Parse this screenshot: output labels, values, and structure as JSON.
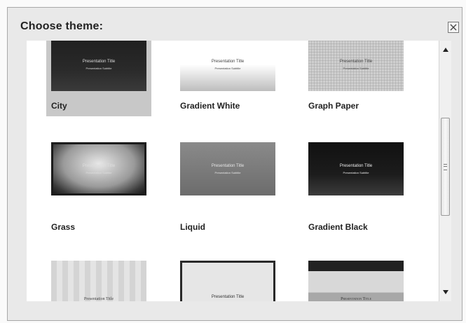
{
  "dialog": {
    "title": "Choose theme:"
  },
  "themes": [
    {
      "label": "City",
      "thumb_title": "Presentation Title",
      "thumb_subtitle": "Presentation Subtitle",
      "selected": true
    },
    {
      "label": "Gradient White",
      "thumb_title": "Presentation Title",
      "thumb_subtitle": "Presentation Subtitle",
      "selected": false
    },
    {
      "label": "Graph Paper",
      "thumb_title": "Presentation Title",
      "thumb_subtitle": "Presentation Subtitle",
      "selected": false
    },
    {
      "label": "Grass",
      "thumb_title": "Presentation Title",
      "thumb_subtitle": "Presentation Subtitle",
      "selected": false
    },
    {
      "label": "Liquid",
      "thumb_title": "Presentation Title",
      "thumb_subtitle": "Presentation Subtitle",
      "selected": false
    },
    {
      "label": "Gradient Black",
      "thumb_title": "Presentation Title",
      "thumb_subtitle": "Presentation Subtitle",
      "selected": false
    },
    {
      "label": "",
      "thumb_title": "Presentation Title",
      "thumb_subtitle": "",
      "selected": false
    },
    {
      "label": "",
      "thumb_title": "Presentation Title",
      "thumb_subtitle": "",
      "selected": false
    },
    {
      "label": "",
      "thumb_title": "Presentation Title",
      "thumb_subtitle": "",
      "selected": false
    }
  ],
  "icons": {
    "close": "close-icon",
    "scroll_up": "scroll-up-arrow-icon",
    "scroll_down": "scroll-down-arrow-icon"
  },
  "colors": {
    "dialog_bg": "#e9e9e9",
    "selected_tile": "#c8c8c8"
  }
}
